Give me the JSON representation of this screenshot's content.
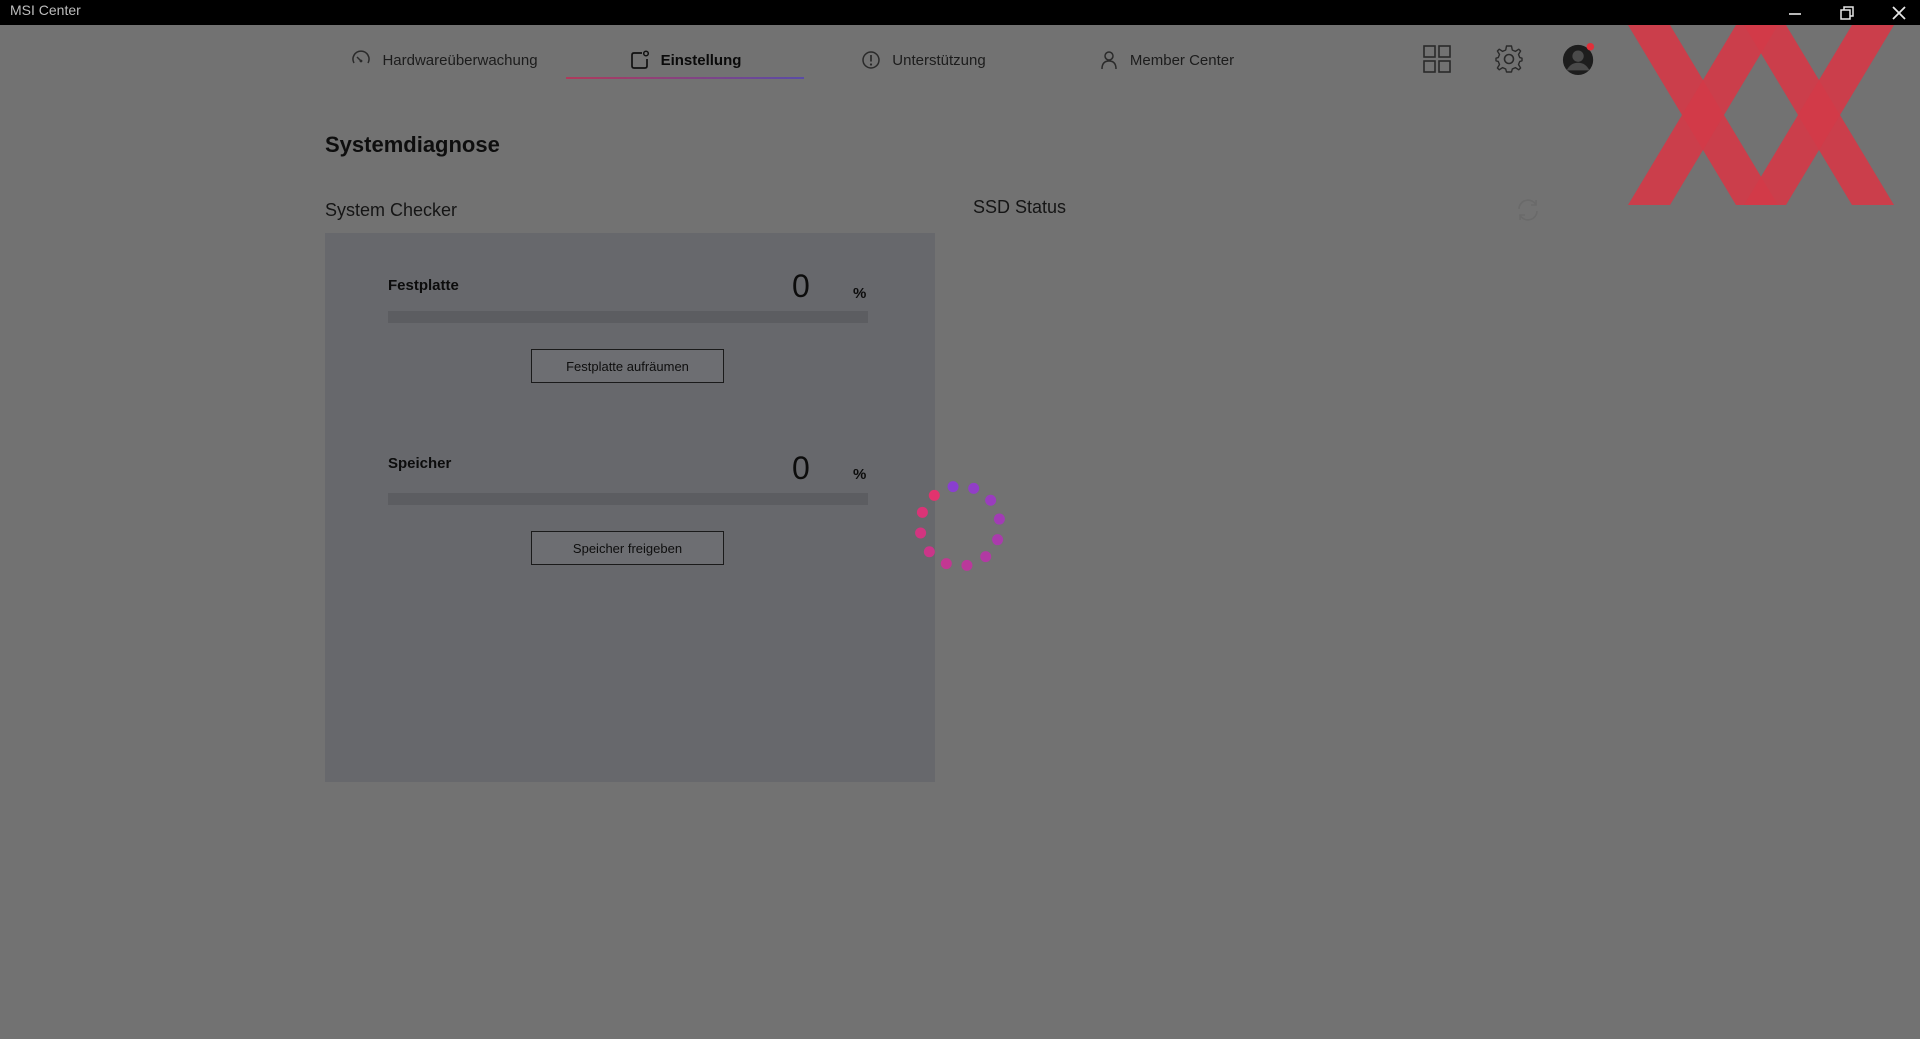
{
  "window": {
    "title": "MSI Center",
    "controls": {
      "minimize": "minimize-icon",
      "maximize": "restore-icon",
      "close": "close-icon"
    }
  },
  "nav": {
    "tabs": [
      {
        "label": "Hardwareüberwachung",
        "icon": "gauge-icon",
        "active": false
      },
      {
        "label": "Einstellung",
        "icon": "settings-doc-icon",
        "active": true
      },
      {
        "label": "Unterstützung",
        "icon": "info-icon",
        "active": false
      },
      {
        "label": "Member Center",
        "icon": "user-icon",
        "active": false
      }
    ],
    "right_icons": [
      "grid-icon",
      "gear-icon",
      "avatar-icon"
    ],
    "notification_dot_color": "#e0303a"
  },
  "page": {
    "title": "Systemdiagnose",
    "system_checker": {
      "title": "System Checker",
      "items": [
        {
          "label": "Festplatte",
          "value": "0",
          "unit": "%",
          "progress": 0,
          "button": "Festplatte aufräumen"
        },
        {
          "label": "Speicher",
          "value": "0",
          "unit": "%",
          "progress": 0,
          "button": "Speicher freigeben"
        }
      ]
    },
    "ssd_status": {
      "title": "SSD Status",
      "refresh_icon": "refresh-icon",
      "loading": true
    }
  },
  "colors": {
    "accent_start": "#b03a5b",
    "accent_end": "#5a4ca6",
    "brand_red": "#d23a48",
    "spinner_start": "#8a3fd0",
    "spinner_end": "#e2336e"
  }
}
